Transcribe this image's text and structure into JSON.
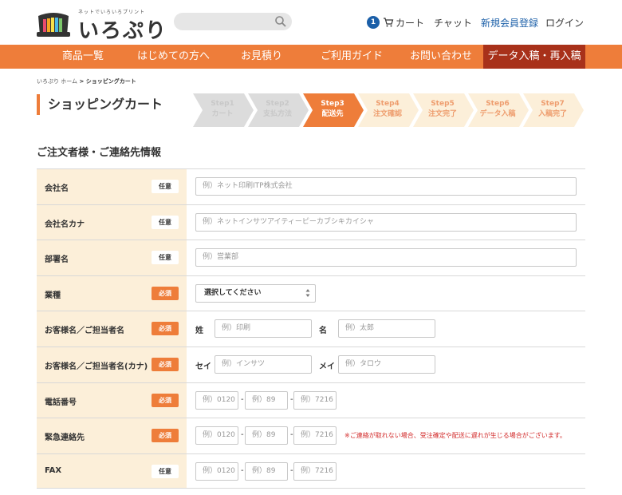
{
  "header": {
    "logo_tagline": "ネットでいろいろプリント",
    "logo_text": "いろぷり",
    "cart_count": "1",
    "cart_label": "カート",
    "chat_label": "チャット",
    "register_label": "新規会員登録",
    "login_label": "ログイン"
  },
  "nav": {
    "items": [
      {
        "label": "商品一覧"
      },
      {
        "label": "はじめての方へ"
      },
      {
        "label": "お見積り"
      },
      {
        "label": "ご利用ガイド"
      },
      {
        "label": "お問い合わせ"
      },
      {
        "label": "データ入稿・再入稿"
      }
    ]
  },
  "breadcrumb": {
    "home": "いろぷり ホーム",
    "separator": " > ",
    "current": "ショッピングカート"
  },
  "page_title": "ショッピングカート",
  "steps": [
    {
      "step": "Step1",
      "label": "カート",
      "state": "inactive"
    },
    {
      "step": "Step2",
      "label": "支払方法",
      "state": "inactive"
    },
    {
      "step": "Step3",
      "label": "配送先",
      "state": "active"
    },
    {
      "step": "Step4",
      "label": "注文確認",
      "state": "pending"
    },
    {
      "step": "Step5",
      "label": "注文完了",
      "state": "pending"
    },
    {
      "step": "Step6",
      "label": "データ入稿",
      "state": "pending"
    },
    {
      "step": "Step7",
      "label": "入稿完了",
      "state": "pending"
    }
  ],
  "section_title": "ご注文者様・ご連絡先情報",
  "tags": {
    "optional": "任意",
    "required": "必須"
  },
  "form": {
    "company": {
      "label": "会社名",
      "placeholder": "例）ネット印刷ITP株式会社"
    },
    "company_kana": {
      "label": "会社名カナ",
      "placeholder": "例）ネットインサツアイティーピーカブシキカイシャ"
    },
    "department": {
      "label": "部署名",
      "placeholder": "例）営業部"
    },
    "industry": {
      "label": "業種",
      "selected": "選択してください"
    },
    "name": {
      "label": "お客様名／ご担当者名",
      "sei_label": "姓",
      "sei_placeholder": "例）印刷",
      "mei_label": "名",
      "mei_placeholder": "例）太郎"
    },
    "name_kana": {
      "label": "お客様名／ご担当者名(カナ)",
      "sei_label": "セイ",
      "sei_placeholder": "例）インサツ",
      "mei_label": "メイ",
      "mei_placeholder": "例）タロウ"
    },
    "phone": {
      "label": "電話番号",
      "p1": "例）0120",
      "p2": "例）89",
      "p3": "例）7216"
    },
    "emergency": {
      "label": "緊急連絡先",
      "p1": "例）0120",
      "p2": "例）89",
      "p3": "例）7216",
      "note": "※ご連絡が取れない場合、受注確定や配送に遅れが生じる場合がございます。"
    },
    "fax": {
      "label": "FAX",
      "p1": "例）0120",
      "p2": "例）89",
      "p3": "例）7216"
    }
  },
  "colors": {
    "accent": "#ee7d3a",
    "nav_active": "#a8311a",
    "label_bg": "#fcefd9",
    "link": "#1b5fa8",
    "note": "#d22a2a"
  }
}
